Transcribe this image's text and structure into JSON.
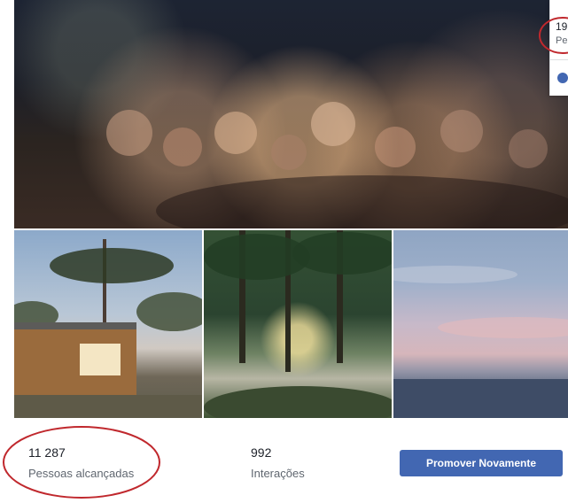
{
  "popup": {
    "title": "19",
    "subtitle": "Pe"
  },
  "stats": {
    "reach": {
      "value": "11 287",
      "label": "Pessoas alcançadas"
    },
    "engagement": {
      "value": "992",
      "label": "Interações"
    },
    "promote_label": "Promover Novamente"
  },
  "colors": {
    "button": "#4267b2",
    "annotation": "#c0282d",
    "secondary_text": "#606770"
  }
}
